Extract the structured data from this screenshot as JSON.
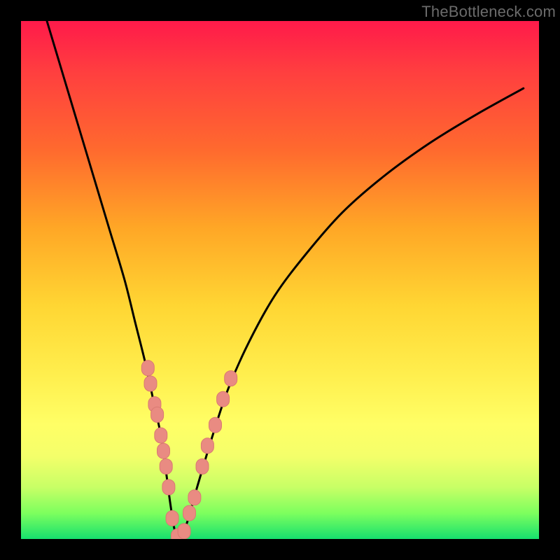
{
  "watermark": {
    "text": "TheBottleneck.com"
  },
  "colors": {
    "curve_stroke": "#000000",
    "marker_fill": "#e98b82",
    "marker_stroke": "#d97a72"
  },
  "chart_data": {
    "type": "line",
    "title": "",
    "xlabel": "",
    "ylabel": "",
    "xlim": [
      0,
      100
    ],
    "ylim": [
      0,
      100
    ],
    "grid": false,
    "series": [
      {
        "name": "bottleneck-curve",
        "x": [
          5,
          8,
          11,
          14,
          17,
          20,
          22,
          24,
          25.5,
          27,
          28,
          28.8,
          29.6,
          30.4,
          32,
          34,
          37,
          40,
          44,
          49,
          55,
          62,
          70,
          79,
          88,
          97
        ],
        "values": [
          100,
          90,
          80,
          70,
          60,
          50,
          42,
          34,
          27,
          20,
          13,
          7,
          2,
          0,
          3,
          10,
          20,
          29,
          38,
          47,
          55,
          63,
          70,
          76.5,
          82,
          87
        ]
      }
    ],
    "markers": {
      "name": "highlighted-points",
      "x": [
        24.5,
        25.0,
        25.8,
        26.3,
        27.0,
        27.5,
        28.0,
        28.5,
        29.2,
        30.2,
        31.5,
        32.5,
        33.5,
        35.0,
        36.0,
        37.5,
        39.0,
        40.5
      ],
      "values": [
        33,
        30,
        26,
        24,
        20,
        17,
        14,
        10,
        4,
        0.5,
        1.5,
        5,
        8,
        14,
        18,
        22,
        27,
        31
      ]
    }
  }
}
